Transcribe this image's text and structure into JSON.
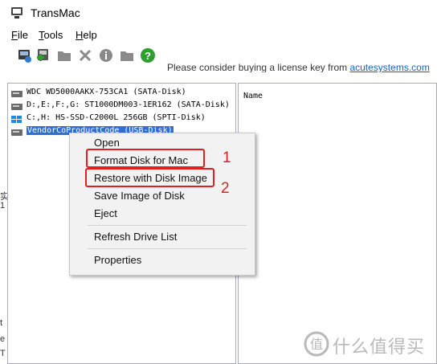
{
  "window": {
    "title": "TransMac"
  },
  "menu": [
    {
      "label": "File",
      "accel": "F",
      "rest": "ile"
    },
    {
      "label": "Tools",
      "accel": "T",
      "rest": "ools"
    },
    {
      "label": "Help",
      "accel": "H",
      "rest": "elp"
    }
  ],
  "toolbar": {
    "icons": [
      "disk-refresh-icon",
      "add-disk-icon",
      "folder-icon",
      "delete-icon",
      "info-icon",
      "folder-icon",
      "help-icon"
    ]
  },
  "banner": {
    "text": "Please consider buying a license key from ",
    "link": "acutesystems.com"
  },
  "drives": [
    {
      "label": "WDC WD5000AAKX-753CA1 (SATA-Disk)",
      "icon": "hard-disk-icon",
      "selected": false
    },
    {
      "label": "D:,E:,F:,G: ST1000DM003-1ER162 (SATA-Disk)",
      "icon": "hard-disk-icon",
      "selected": false
    },
    {
      "label": "C:,H: HS-SSD-C2000L 256GB (SPTI-Disk)",
      "icon": "windows-disk-icon",
      "selected": false
    },
    {
      "label": "VendorCoProductCode (USB-Disk)",
      "icon": "usb-disk-icon",
      "selected": true
    }
  ],
  "right_panel": {
    "column": "Name"
  },
  "context_menu": {
    "items": [
      {
        "label": "Open"
      },
      {
        "label": "Format Disk for Mac"
      },
      {
        "label": "Restore with Disk Image"
      },
      {
        "label": "Save Image of Disk"
      },
      {
        "label": "Eject"
      },
      {
        "label": "Refresh Drive List"
      },
      {
        "label": "Properties"
      }
    ]
  },
  "annotations": [
    {
      "number": "1"
    },
    {
      "number": "2"
    }
  ],
  "left_edge": [
    "实",
    "1",
    "t",
    "e",
    "T"
  ],
  "watermark": {
    "text": "什么值得买"
  },
  "colors": {
    "highlight": "#e02020",
    "selection": "#2f6ed3",
    "help_icon": "#2e9e2e"
  }
}
